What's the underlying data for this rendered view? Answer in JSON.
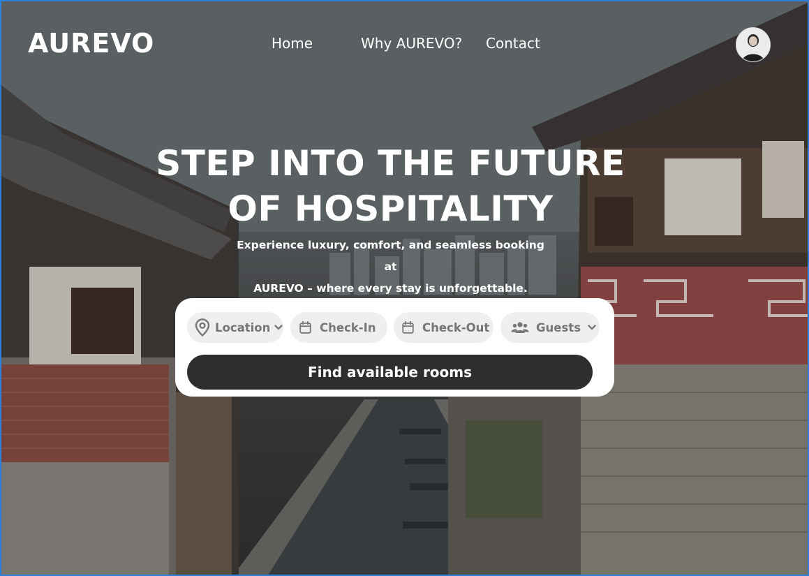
{
  "brand": {
    "logo": "AUREVO"
  },
  "nav": {
    "items": [
      {
        "label": "Home"
      },
      {
        "label": "Why AUREVO?"
      },
      {
        "label": "Contact"
      }
    ]
  },
  "hero": {
    "title_line1": "STEP INTO THE FUTURE",
    "title_line2": "OF HOSPITALITY",
    "subtitle_line1": "Experience luxury, comfort, and seamless booking at",
    "subtitle_line2": "AUREVO – where every stay is unforgettable."
  },
  "search": {
    "location": {
      "label": "Location",
      "icon": "map-pin-icon"
    },
    "check_in": {
      "label": "Check-In",
      "icon": "calendar-icon"
    },
    "check_out": {
      "label": "Check-Out",
      "icon": "calendar-icon"
    },
    "guests": {
      "label": "Guests",
      "icon": "users-icon"
    },
    "submit_label": "Find available rooms"
  },
  "colors": {
    "primary_button": "#2e2e2e",
    "pill_background": "#efefef",
    "pill_text": "#777777",
    "frame_border": "#2f7fd6"
  }
}
